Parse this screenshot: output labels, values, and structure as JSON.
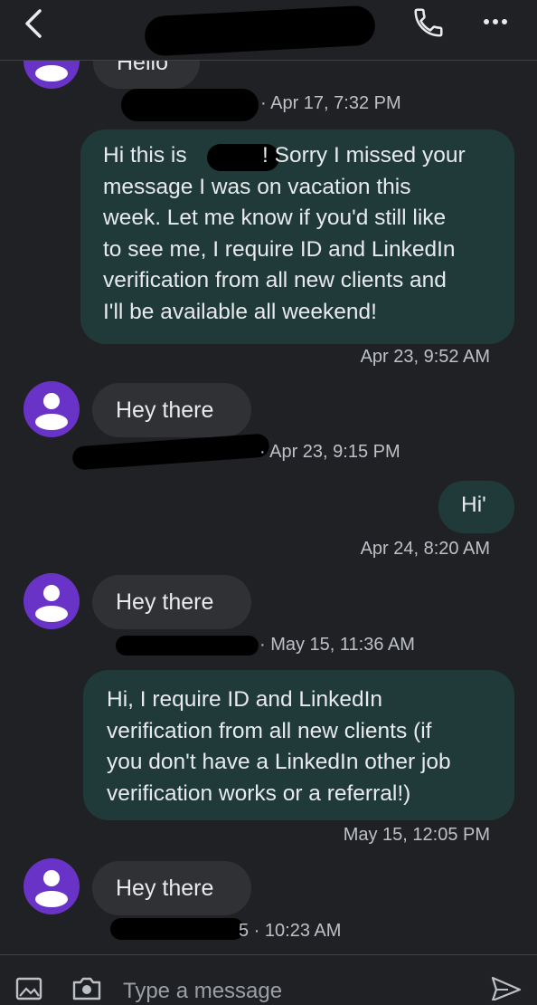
{
  "header": {
    "back_icon": "chevron-left-icon",
    "call_icon": "phone-icon",
    "more_icon": "more-horizontal-icon"
  },
  "messages": [
    {
      "direction": "incoming",
      "text": "Hello",
      "meta": "· Apr 17, 7:32 PM"
    },
    {
      "direction": "outgoing",
      "text_lines": [
        "Hi this is",
        "! Sorry I missed your",
        "message I was on vacation this",
        "week. Let me know if you'd still like",
        "to see me, I require ID and LinkedIn",
        "verification from all new clients and",
        "I'll be available all weekend!"
      ],
      "meta": "Apr 23, 9:52 AM"
    },
    {
      "direction": "incoming",
      "text": "Hey there",
      "meta": "· Apr 23, 9:15 PM"
    },
    {
      "direction": "outgoing",
      "text": "Hi'",
      "meta": "Apr 24, 8:20 AM"
    },
    {
      "direction": "incoming",
      "text": "Hey there",
      "meta": "· May 15, 11:36 AM"
    },
    {
      "direction": "outgoing",
      "text_lines": [
        "Hi, I require ID and LinkedIn",
        "verification from all new clients (if",
        "you don't have a LinkedIn other job",
        "verification works or a referral!)"
      ],
      "meta": "May 15, 12:05 PM"
    },
    {
      "direction": "incoming",
      "text": "Hey there",
      "meta": "5 · 10:23 AM"
    }
  ],
  "compose": {
    "placeholder": "Type a message",
    "gallery_icon": "image-icon",
    "camera_icon": "camera-icon",
    "send_icon": "send-icon"
  },
  "colors": {
    "background": "#202124",
    "incoming_bubble": "#303134",
    "outgoing_bubble": "#1f3a38",
    "avatar": "#6a33c7",
    "accent_icon": "#7cacf8"
  }
}
